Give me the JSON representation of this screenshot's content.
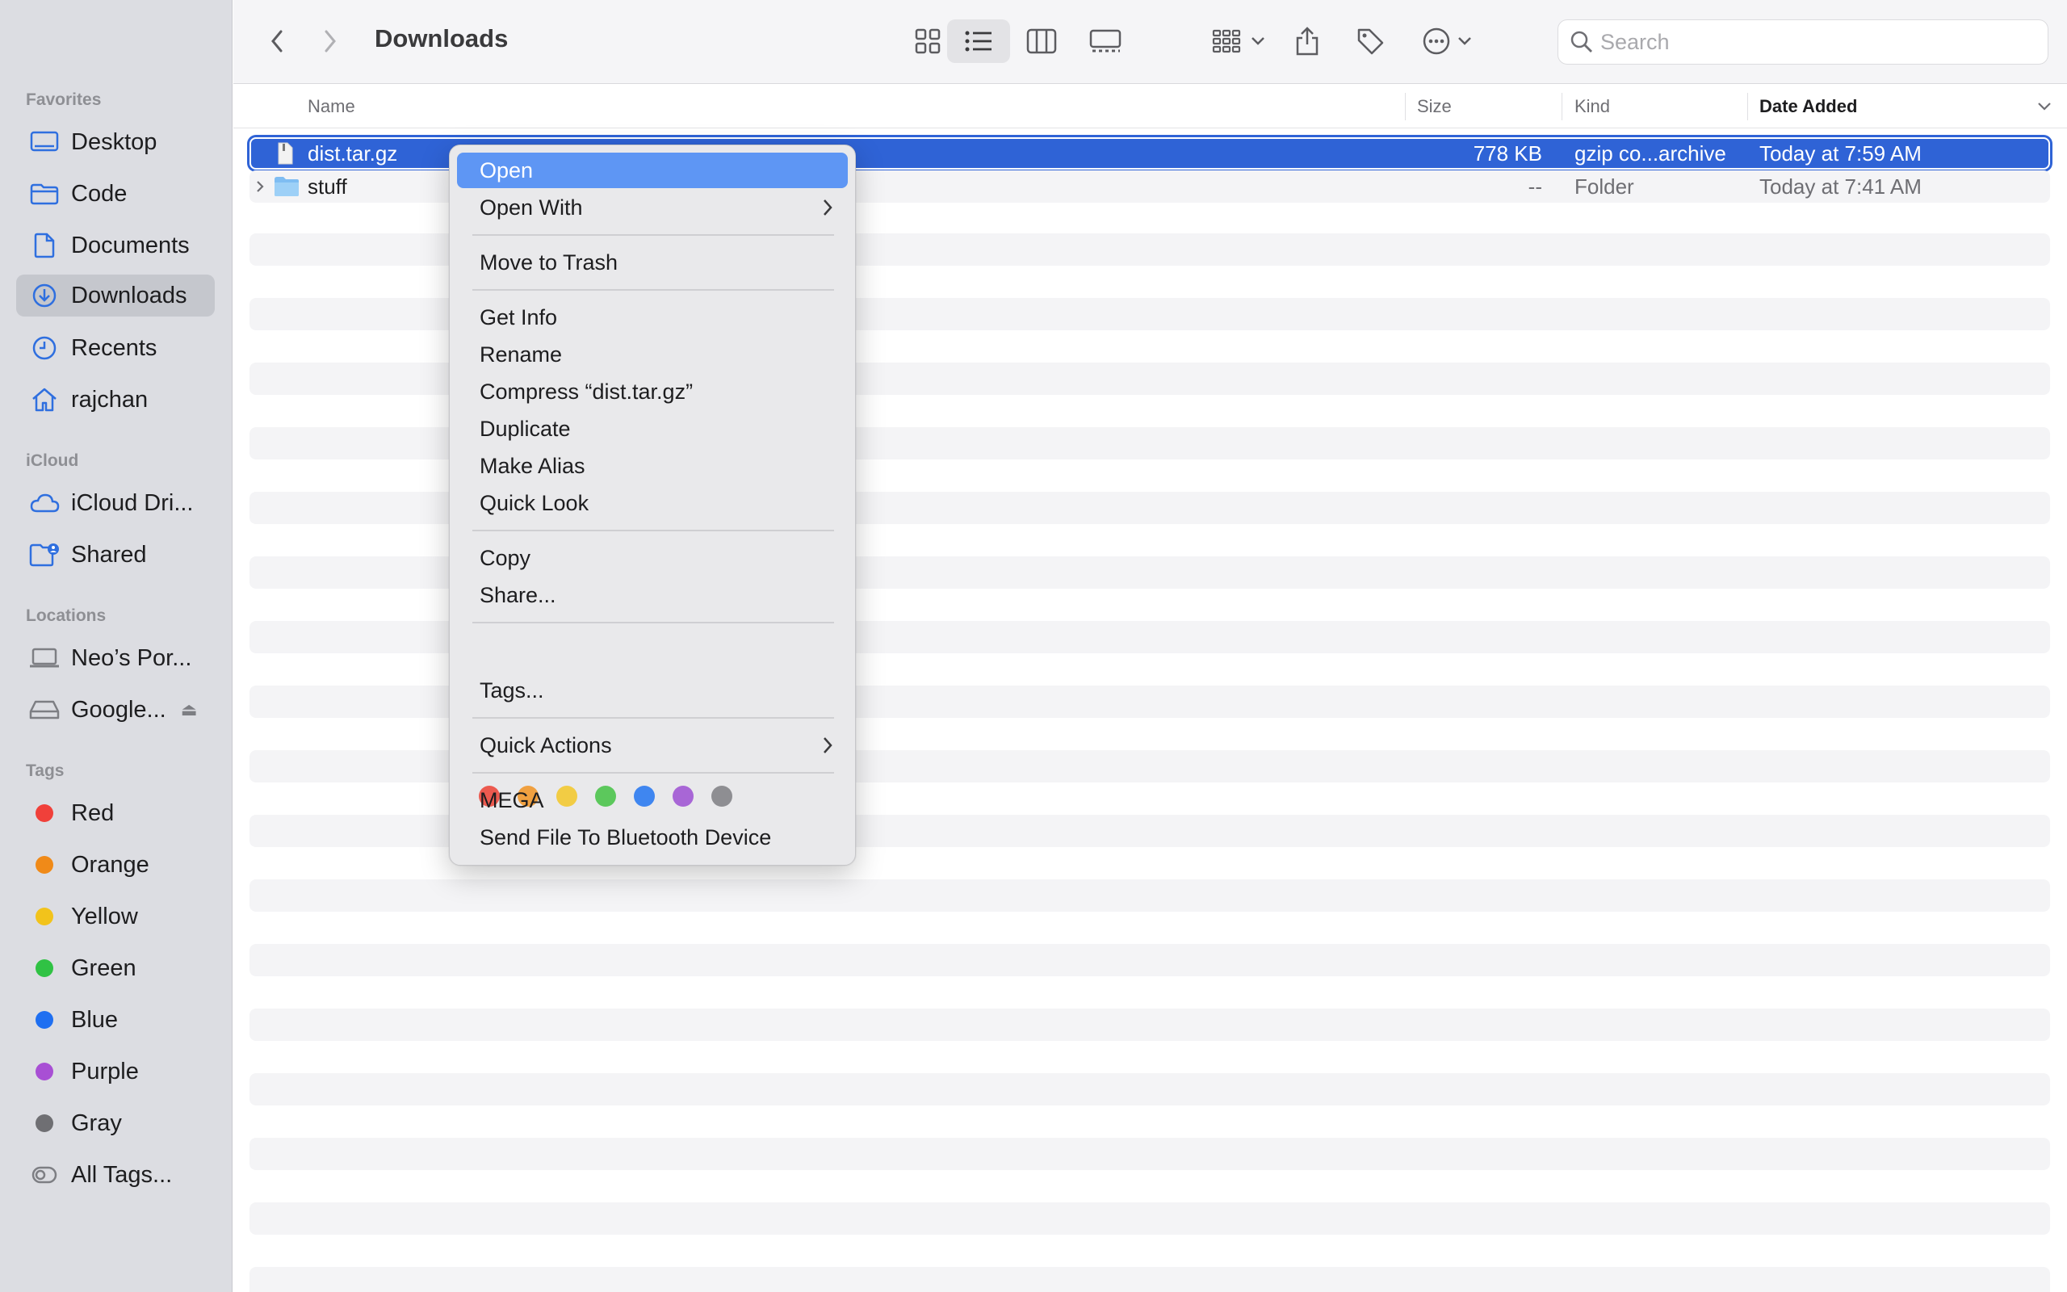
{
  "window": {
    "title": "Downloads"
  },
  "sidebar": {
    "sections": {
      "favorites": "Favorites",
      "icloud": "iCloud",
      "locations": "Locations",
      "tags": "Tags"
    },
    "favorites": [
      {
        "label": "Desktop",
        "icon": "desktop-icon"
      },
      {
        "label": "Code",
        "icon": "folder-icon"
      },
      {
        "label": "Documents",
        "icon": "document-icon"
      },
      {
        "label": "Downloads",
        "icon": "download-icon",
        "active": true
      },
      {
        "label": "Recents",
        "icon": "clock-icon"
      },
      {
        "label": "rajchan",
        "icon": "home-icon"
      }
    ],
    "icloud": [
      {
        "label": "iCloud Dri...",
        "icon": "cloud-icon"
      },
      {
        "label": "Shared",
        "icon": "shared-folder-icon"
      }
    ],
    "locations": [
      {
        "label": "Neo’s Por...",
        "icon": "laptop-icon"
      },
      {
        "label": "Google...",
        "icon": "drive-icon"
      }
    ],
    "tags": [
      {
        "label": "Red",
        "color": "#f0403a"
      },
      {
        "label": "Orange",
        "color": "#f08a18"
      },
      {
        "label": "Yellow",
        "color": "#f2c31b"
      },
      {
        "label": "Green",
        "color": "#30c244"
      },
      {
        "label": "Blue",
        "color": "#1f6ff1"
      },
      {
        "label": "Purple",
        "color": "#a84fd4"
      },
      {
        "label": "Gray",
        "color": "#6f6f73"
      },
      {
        "label": "All Tags...",
        "color": ""
      }
    ]
  },
  "toolbar": {
    "search_placeholder": "Search"
  },
  "columns": {
    "name": "Name",
    "size": "Size",
    "kind": "Kind",
    "date_added": "Date Added"
  },
  "files": [
    {
      "name": "dist.tar.gz",
      "size": "778 KB",
      "kind": "gzip co...archive",
      "date_added": "Today at 7:59 AM",
      "selected": true
    },
    {
      "name": "stuff",
      "size": "--",
      "kind": "Folder",
      "date_added": "Today at 7:41 AM",
      "selected": false
    }
  ],
  "context_menu": {
    "open": "Open",
    "open_with": "Open With",
    "move_to_trash": "Move to Trash",
    "get_info": "Get Info",
    "rename": "Rename",
    "compress": "Compress “dist.tar.gz”",
    "duplicate": "Duplicate",
    "make_alias": "Make Alias",
    "quick_look": "Quick Look",
    "copy": "Copy",
    "share": "Share...",
    "tag_colors": [
      "#ec5a4f",
      "#f0a040",
      "#f2cc44",
      "#5cc85c",
      "#3f86f0",
      "#a866d6",
      "#8e8e92"
    ],
    "tags": "Tags...",
    "quick_actions": "Quick Actions",
    "mega": "MEGA",
    "send_bluetooth": "Send File To Bluetooth Device"
  }
}
